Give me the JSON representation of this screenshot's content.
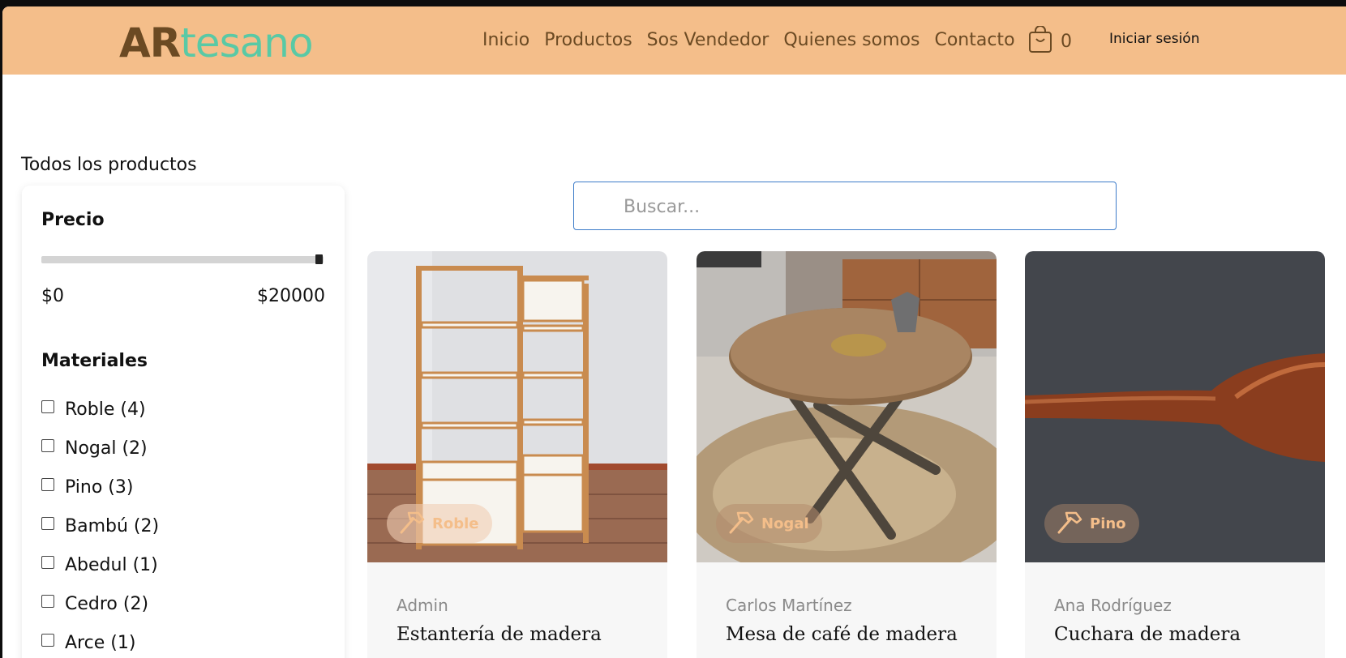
{
  "header": {
    "logo_strong": "AR",
    "logo_rest": "tesano",
    "nav": [
      "Inicio",
      "Productos",
      "Sos Vendedor",
      "Quienes somos",
      "Contacto"
    ],
    "cart_count": "0",
    "login_label": "Iniciar sesión"
  },
  "page_title": "Todos los productos",
  "filters": {
    "price_heading": "Precio",
    "price_min": "$0",
    "price_max": "$20000",
    "materials_heading": "Materiales",
    "materials": [
      "Roble (4)",
      "Nogal (2)",
      "Pino (3)",
      "Bambú (2)",
      "Abedul (1)",
      "Cedro (2)",
      "Arce (1)"
    ]
  },
  "search": {
    "placeholder": "Buscar..."
  },
  "products": [
    {
      "material": "Roble",
      "author": "Admin",
      "title": "Estantería de madera"
    },
    {
      "material": "Nogal",
      "author": "Carlos Martínez",
      "title": "Mesa de café de madera"
    },
    {
      "material": "Pino",
      "author": "Ana Rodríguez",
      "title": "Cuchara de madera"
    }
  ],
  "colors": {
    "header_bg": "#f4be8a",
    "logo_brown": "#6b4a23",
    "logo_teal": "#59c9a5",
    "search_border": "#3d7cc9"
  }
}
